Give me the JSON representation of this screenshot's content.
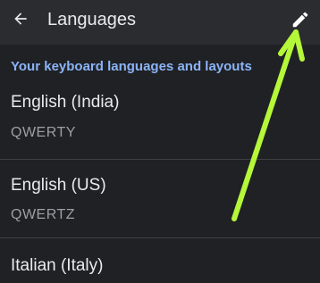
{
  "appbar": {
    "title": "Languages",
    "back_icon": "arrow-back-icon",
    "edit_icon": "pencil-icon"
  },
  "section": {
    "header": "Your keyboard languages and layouts"
  },
  "languages": [
    {
      "name": "English (India)",
      "layout": "QWERTY"
    },
    {
      "name": "English (US)",
      "layout": "QWERTZ"
    },
    {
      "name": "Italian (Italy)",
      "layout": ""
    }
  ],
  "colors": {
    "background": "#202124",
    "appbar": "#2b2c30",
    "accent": "#8ab4f8",
    "annotation_arrow": "#b5f739"
  }
}
